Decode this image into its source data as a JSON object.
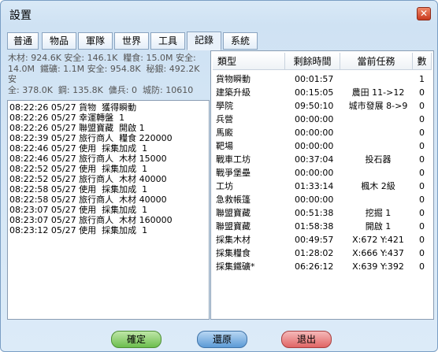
{
  "window": {
    "title": "設置"
  },
  "tabs": [
    {
      "label": "普通"
    },
    {
      "label": "物品"
    },
    {
      "label": "軍隊"
    },
    {
      "label": "世界"
    },
    {
      "label": "工具"
    },
    {
      "label": "記錄"
    },
    {
      "label": "系統"
    }
  ],
  "active_tab": "記錄",
  "resources": {
    "line1": "木材: 924.6K 安全: 146.1K  糧食: 15.0M 安全:",
    "line2": "14.0M  鐵礦: 1.1M 安全: 954.8K  秘銀: 492.2K 安",
    "line3": "全: 378.0K  鋼: 135.8K  傭兵: 0  城防: 10610"
  },
  "log": [
    "08:22:26 05/27 貨物  獲得瞬動",
    "08:22:26 05/27 幸運轉盤  1",
    "08:22:26 05/27 聯盟寶藏  開啟 1",
    "08:22:39 05/27 旅行商人  糧食 220000",
    "08:22:46 05/27 使用  採集加成  1",
    "08:22:46 05/27 旅行商人  木材 15000",
    "08:22:52 05/27 使用  採集加成  1",
    "08:22:52 05/27 旅行商人  木材 40000",
    "08:22:58 05/27 使用  採集加成  1",
    "08:22:58 05/27 旅行商人  木材 40000",
    "08:23:07 05/27 使用  採集加成  1",
    "08:23:07 05/27 旅行商人  木材 160000",
    "08:23:12 05/27 使用  採集加成  1"
  ],
  "tasks": {
    "headers": [
      "類型",
      "剩餘時間",
      "當前任務",
      "數"
    ],
    "rows": [
      {
        "type": "貨物瞬動",
        "time": "00:01:57",
        "task": "",
        "count": "1"
      },
      {
        "type": "建築升級",
        "time": "00:15:05",
        "task": "農田 11->12",
        "count": "0"
      },
      {
        "type": "學院",
        "time": "09:50:10",
        "task": "城市發展 8->9",
        "count": "0"
      },
      {
        "type": "兵營",
        "time": "00:00:00",
        "task": "",
        "count": "0"
      },
      {
        "type": "馬廄",
        "time": "00:00:00",
        "task": "",
        "count": "0"
      },
      {
        "type": "靶場",
        "time": "00:00:00",
        "task": "",
        "count": "0"
      },
      {
        "type": "戰車工坊",
        "time": "00:37:04",
        "task": "投石器",
        "count": "0"
      },
      {
        "type": "戰爭堡壘",
        "time": "00:00:00",
        "task": "",
        "count": "0"
      },
      {
        "type": "工坊",
        "time": "01:33:14",
        "task": "楓木 2級",
        "count": "0"
      },
      {
        "type": "急救帳篷",
        "time": "00:00:00",
        "task": "",
        "count": "0"
      },
      {
        "type": "聯盟寶藏",
        "time": "00:51:38",
        "task": "挖掘 1",
        "count": "0"
      },
      {
        "type": "聯盟寶藏",
        "time": "01:58:38",
        "task": "開啟 1",
        "count": "0"
      },
      {
        "type": "採集木材",
        "time": "00:49:57",
        "task": "X:672 Y:421",
        "count": "0"
      },
      {
        "type": "採集糧食",
        "time": "01:28:02",
        "task": "X:666 Y:437",
        "count": "0"
      },
      {
        "type": "採集鐵礦*",
        "time": "06:26:12",
        "task": "X:639 Y:392",
        "count": "0"
      }
    ]
  },
  "buttons": {
    "ok": "確定",
    "restore": "還原",
    "exit": "退出"
  },
  "colors": {
    "ok": "#6cbe4e",
    "restore": "#5c9ad6",
    "exit": "#e06565"
  }
}
